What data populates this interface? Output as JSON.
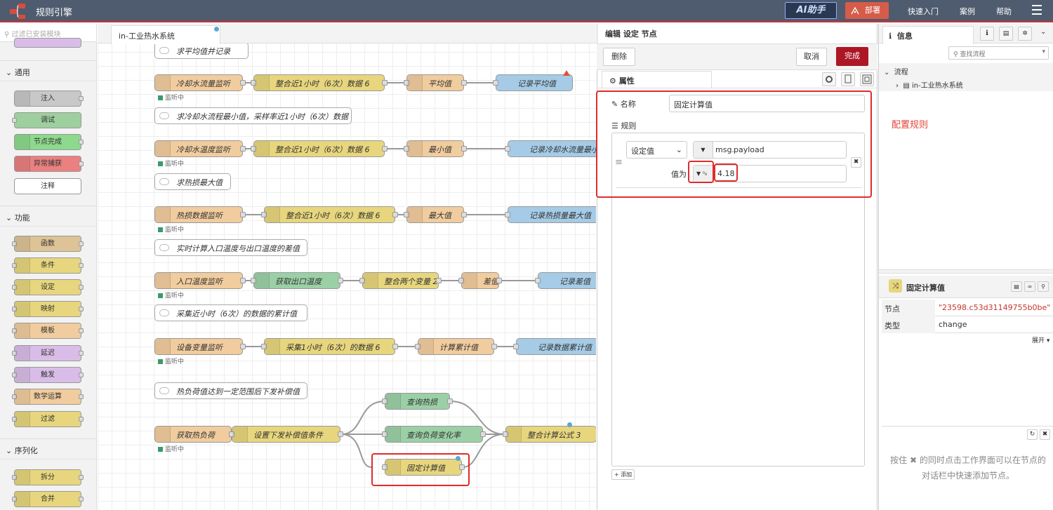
{
  "header": {
    "title": "规则引擎",
    "ai_button": "AI助手",
    "deploy": "部署",
    "menu": [
      "快速入门",
      "案例",
      "帮助"
    ]
  },
  "palette": {
    "filter_placeholder": "过滤已安装模块",
    "categories": [
      {
        "label": "通用",
        "nodes": [
          "注入",
          "调试",
          "节点完成",
          "异常捕获",
          "注释"
        ]
      },
      {
        "label": "功能",
        "nodes": [
          "函数",
          "条件",
          "设定",
          "映射",
          "模板",
          "延迟",
          "触发",
          "数学运算",
          "过滤"
        ]
      },
      {
        "label": "序列化",
        "nodes": [
          "拆分",
          "合并"
        ]
      }
    ]
  },
  "workspace": {
    "tab": "in-工业热水系统",
    "status_text": "监听中",
    "comments": [
      "求平均值并记录",
      "求冷却水流程最小值，采样率近1小时（6次）数据",
      "求热损最大值",
      "实时计算入口温度与出口温度的差值",
      "采集近小时（6次）的数据的累计值",
      "热负荷值达到一定范围后下发补偿值"
    ],
    "rows": [
      [
        "冷却水流量监听",
        "整合近1小时（6次）数据 6",
        "平均值",
        "记录平均值"
      ],
      [
        "冷却水温度监听",
        "整合近1小时（6次）数据 6",
        "最小值",
        "记录冷却水流量最小值"
      ],
      [
        "热损数据监听",
        "整合近1小时（6次）数据 6",
        "最大值",
        "记录热损量最大值"
      ],
      [
        "入口温度监听",
        "获取出口温度",
        "整合两个变量 2",
        "差值",
        "记录差值"
      ],
      [
        "设备变量监听",
        "采集1小时（6次）的数据 6",
        "计算累计值",
        "记录数据累计值"
      ],
      [
        "获取热负荷",
        "设置下发补偿值条件",
        "查询热损",
        "查询负荷变化率",
        "固定计算值",
        "整合计算公式 3"
      ]
    ]
  },
  "editor": {
    "title": "编辑 设定 节点",
    "delete": "删除",
    "cancel": "取消",
    "done": "完成",
    "tab_properties": "属性",
    "name_label": "名称",
    "name_value": "固定计算值",
    "rules_label": "规则",
    "rule_action": "设定值",
    "rule_target_prefix": "msg.",
    "rule_target": "payload",
    "value_label": "值为",
    "value_type": "⁰₉",
    "value": "4.18",
    "add": "添加"
  },
  "sidebar": {
    "tab": "信息",
    "search_placeholder": "查找流程",
    "tree_root": "流程",
    "tree_item": "in-工业热水系统",
    "annotation": "配置规则",
    "node_title": "固定计算值",
    "props": [
      {
        "key": "节点",
        "value": "\"23598.c53d31149755b0be\""
      },
      {
        "key": "类型",
        "value": "change"
      }
    ],
    "expand": "展开",
    "help_text": "按住 ✖ 的同时点击工作界面可以在节点的对话栏中快速添加节点。"
  },
  "colors": {
    "header_bg": "#4f5b6e",
    "accent_red": "#ad1625",
    "deploy": "#d65c4a",
    "annotation_red": "#e02b2b"
  }
}
